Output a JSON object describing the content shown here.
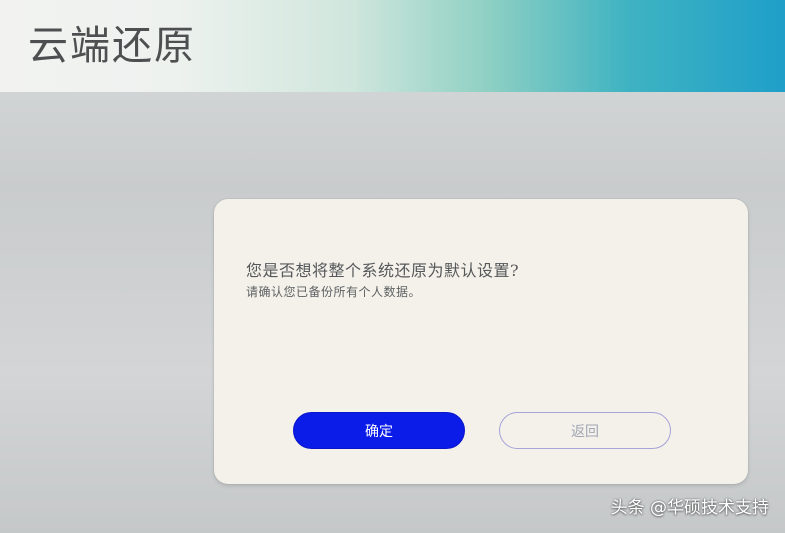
{
  "header": {
    "title": "云端还原"
  },
  "dialog": {
    "question": "您是否想将整个系统还原为默认设置?",
    "subtext": "请确认您已备份所有个人数据。",
    "confirm_label": "确定",
    "back_label": "返回"
  },
  "watermark": {
    "text": "头条 @华硕技术支持"
  },
  "colors": {
    "confirm_button": "#0b1be8",
    "back_button_border": "#a6a4d8",
    "header_accent": "#1f9fc9",
    "dialog_background": "#f4f1ea"
  }
}
